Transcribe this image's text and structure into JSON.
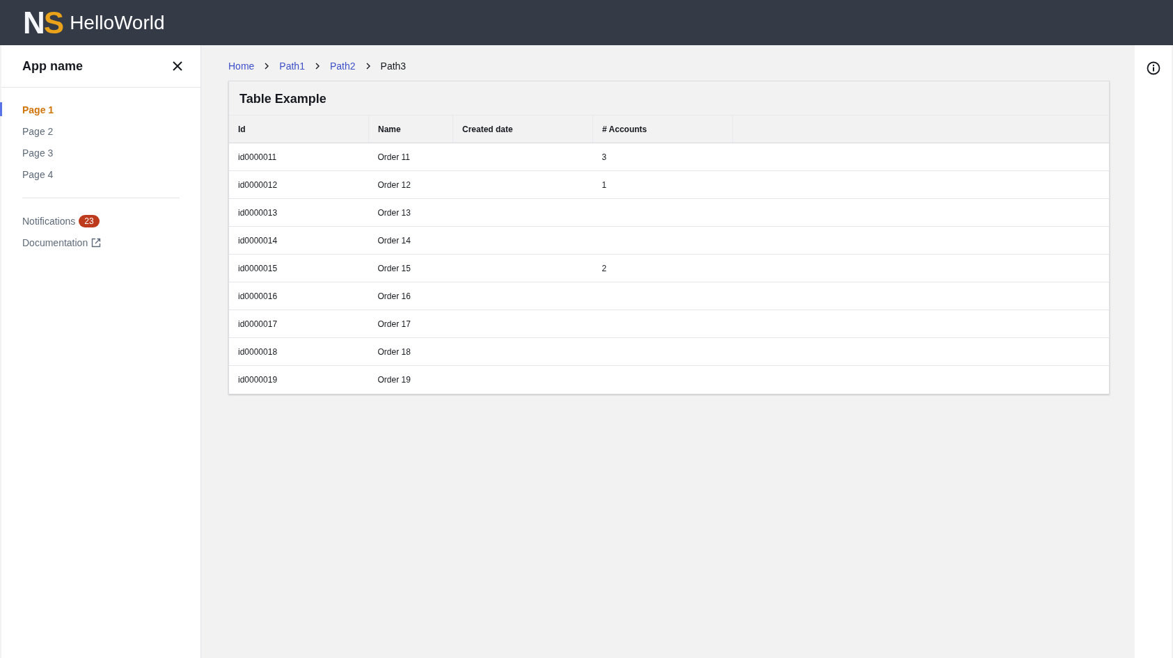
{
  "header": {
    "logo_primary": "N",
    "logo_accent": "S",
    "title": "HelloWorld"
  },
  "sidebar": {
    "title": "App name",
    "items": [
      {
        "label": "Page 1",
        "selected": true
      },
      {
        "label": "Page 2",
        "selected": false
      },
      {
        "label": "Page 3",
        "selected": false
      },
      {
        "label": "Page 4",
        "selected": false
      }
    ],
    "notifications": {
      "label": "Notifications",
      "count": "23"
    },
    "documentation": {
      "label": "Documentation"
    }
  },
  "breadcrumbs": [
    {
      "label": "Home",
      "current": false
    },
    {
      "label": "Path1",
      "current": false
    },
    {
      "label": "Path2",
      "current": false
    },
    {
      "label": "Path3",
      "current": true
    }
  ],
  "table": {
    "title": "Table Example",
    "columns": [
      "Id",
      "Name",
      "Created date",
      "# Accounts"
    ],
    "rows": [
      {
        "id": "id0000011",
        "name": "Order 11",
        "accounts": "3"
      },
      {
        "id": "id0000012",
        "name": "Order 12",
        "accounts": "1"
      },
      {
        "id": "id0000013",
        "name": "Order 13"
      },
      {
        "id": "id0000014",
        "name": "Order 14"
      },
      {
        "id": "id0000015",
        "name": "Order 15",
        "accounts": "2"
      },
      {
        "id": "id0000016",
        "name": "Order 16"
      },
      {
        "id": "id0000017",
        "name": "Order 17"
      },
      {
        "id": "id0000018",
        "name": "Order 18"
      },
      {
        "id": "id0000019",
        "name": "Order 19"
      }
    ]
  }
}
